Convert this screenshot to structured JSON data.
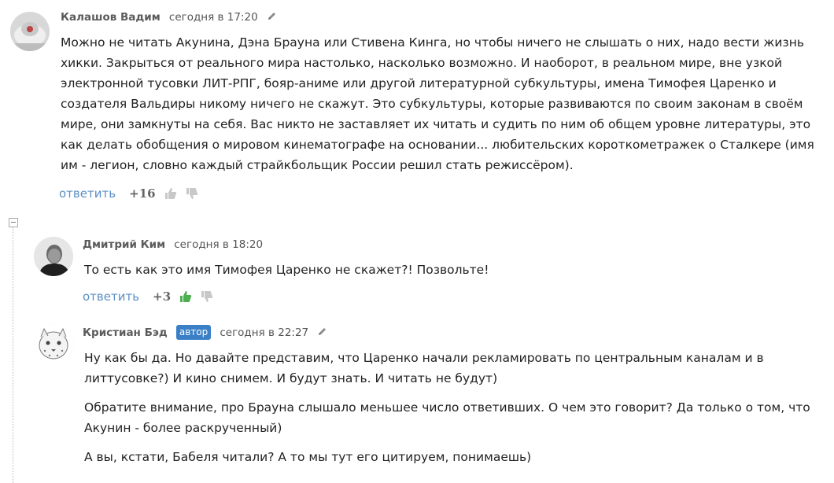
{
  "comments": [
    {
      "author": "Калашов Вадим",
      "date": "сегодня в 17:20",
      "text": "Можно не читать Акунина, Дэна Брауна или Стивена Кинга, но чтобы ничего не слышать о них, надо вести жизнь хикки. Закрыться от реального мира настолько, насколько возможно. И наоборот, в реальном мире, вне узкой электронной тусовки ЛИТ-РПГ, бояр-аниме или другой литературной субкультуры, имена Тимофея Царенко и создателя Вальдиры никому ничего не скажут. Это субкультуры, которые развиваются по своим законам в своём мире, они замкнуты на себя. Вас никто не заставляет их читать и судить по ним об общем уровне литературы, это как делать обобщения о мировом кинематографе на основании... любительских короткометражек о Сталкере (имя им - легион, словно каждый страйкбольщик России решил стать режиссёром).",
      "reply_label": "ответить",
      "score": "+16"
    },
    {
      "author": "Дмитрий Ким",
      "date": "сегодня в 18:20",
      "text": "То есть как это имя Тимофея Царенко не скажет?! Позвольте!",
      "reply_label": "ответить",
      "score": "+3"
    },
    {
      "author": "Кристиан Бэд",
      "badge": "автор",
      "date": "сегодня в 22:27",
      "paragraphs": [
        "Ну как бы да. Но давайте представим, что Царенко начали рекламировать по центральным каналам и в литтусовке?) И кино снимем. И будут знать. И читать не будут)",
        "Обратите внимание, про Брауна слышало меньшее число ответивших. О чем это говорит? Да только о том, что Акунин - более раскрученный)",
        "А вы, кстати, Бабеля читали? А то мы тут его цитируем, понимаешь)"
      ]
    }
  ],
  "colors": {
    "link": "#5a8fc4",
    "badge_bg": "#3b80c6",
    "author": "#5b5b5b",
    "like_active": "#4caf50",
    "vote_inactive": "#c8c8c8"
  },
  "icons": {
    "edit": "pencil-icon",
    "like": "thumbs-up-icon",
    "dislike": "thumbs-down-icon",
    "collapse": "collapse-minus-icon"
  }
}
